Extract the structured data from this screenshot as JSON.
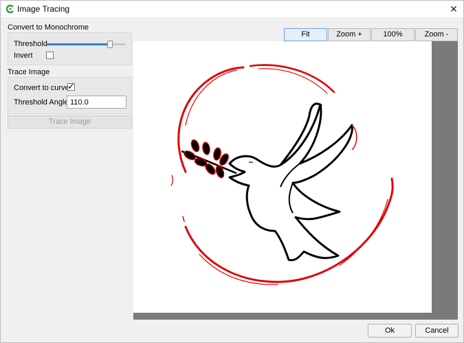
{
  "window": {
    "title": "Image Tracing",
    "close_label": "✕"
  },
  "monochrome": {
    "section_label": "Convert to Monochrome",
    "threshold_label": "Threshold",
    "threshold_fraction": 0.8,
    "invert_label": "Invert",
    "invert_checked": false
  },
  "trace": {
    "section_label": "Trace Image",
    "curves_label": "Convert to curves",
    "curves_checked": true,
    "angle_label": "Threshold Angle",
    "angle_value": "110.0",
    "trace_button": "Trace Image"
  },
  "zoom": {
    "fit": "Fit",
    "zoom_in": "Zoom +",
    "actual": "100%",
    "zoom_out": "Zoom -"
  },
  "dialog": {
    "ok": "Ok",
    "cancel": "Cancel"
  },
  "colors": {
    "accent": "#2f7fd8",
    "trace_red": "#e00000",
    "outline_black": "#000000",
    "preview_bg": "#7a7a7a"
  }
}
